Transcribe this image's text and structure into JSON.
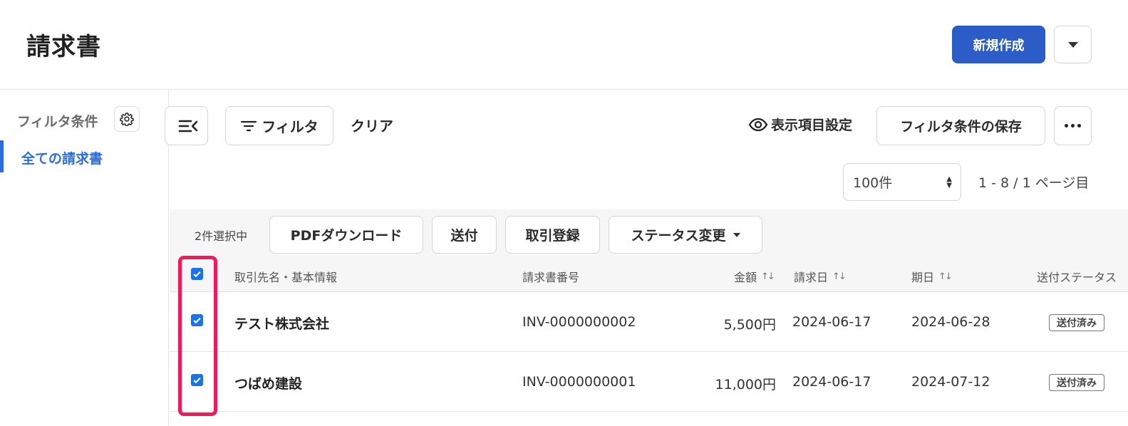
{
  "header": {
    "title": "請求書",
    "new_button": "新規作成"
  },
  "sidebar": {
    "heading": "フィルタ条件",
    "items": [
      {
        "label": "全ての請求書",
        "active": true
      }
    ]
  },
  "toolbar": {
    "filter_button": "フィルタ",
    "clear_button": "クリア",
    "display_settings": "表示項目設定",
    "save_filter_button": "フィルタ条件の保存"
  },
  "paging": {
    "per_page": "100件",
    "info": "1 - 8 / 1 ページ目"
  },
  "bulk": {
    "selected_count": "2件選択中",
    "pdf_download": "PDFダウンロード",
    "send": "送付",
    "register_transaction": "取引登録",
    "status_change": "ステータス変更"
  },
  "table": {
    "columns": {
      "client": "取引先名・基本情報",
      "invoice_no": "請求書番号",
      "amount": "金額",
      "invoice_date": "請求日",
      "due_date": "期日",
      "send_status": "送付ステータス"
    },
    "rows": [
      {
        "client": "テスト株式会社",
        "invoice_no": "INV-0000000002",
        "amount": "5,500円",
        "invoice_date": "2024-06-17",
        "due_date": "2024-06-28",
        "status": "送付済み",
        "checked": true
      },
      {
        "client": "つばめ建設",
        "invoice_no": "INV-0000000001",
        "amount": "11,000円",
        "invoice_date": "2024-06-17",
        "due_date": "2024-07-12",
        "status": "送付済み",
        "checked": true
      }
    ]
  },
  "colors": {
    "primary": "#2b5cc8",
    "active_link": "#2b6de0",
    "checkbox": "#1a73e8",
    "highlight": "#f0195c"
  },
  "icons": [
    "chevron-down-icon",
    "gear-icon",
    "collapse-sidebar-icon",
    "filter-icon",
    "eye-icon",
    "more-dots-icon",
    "sort-icon",
    "check-icon"
  ]
}
